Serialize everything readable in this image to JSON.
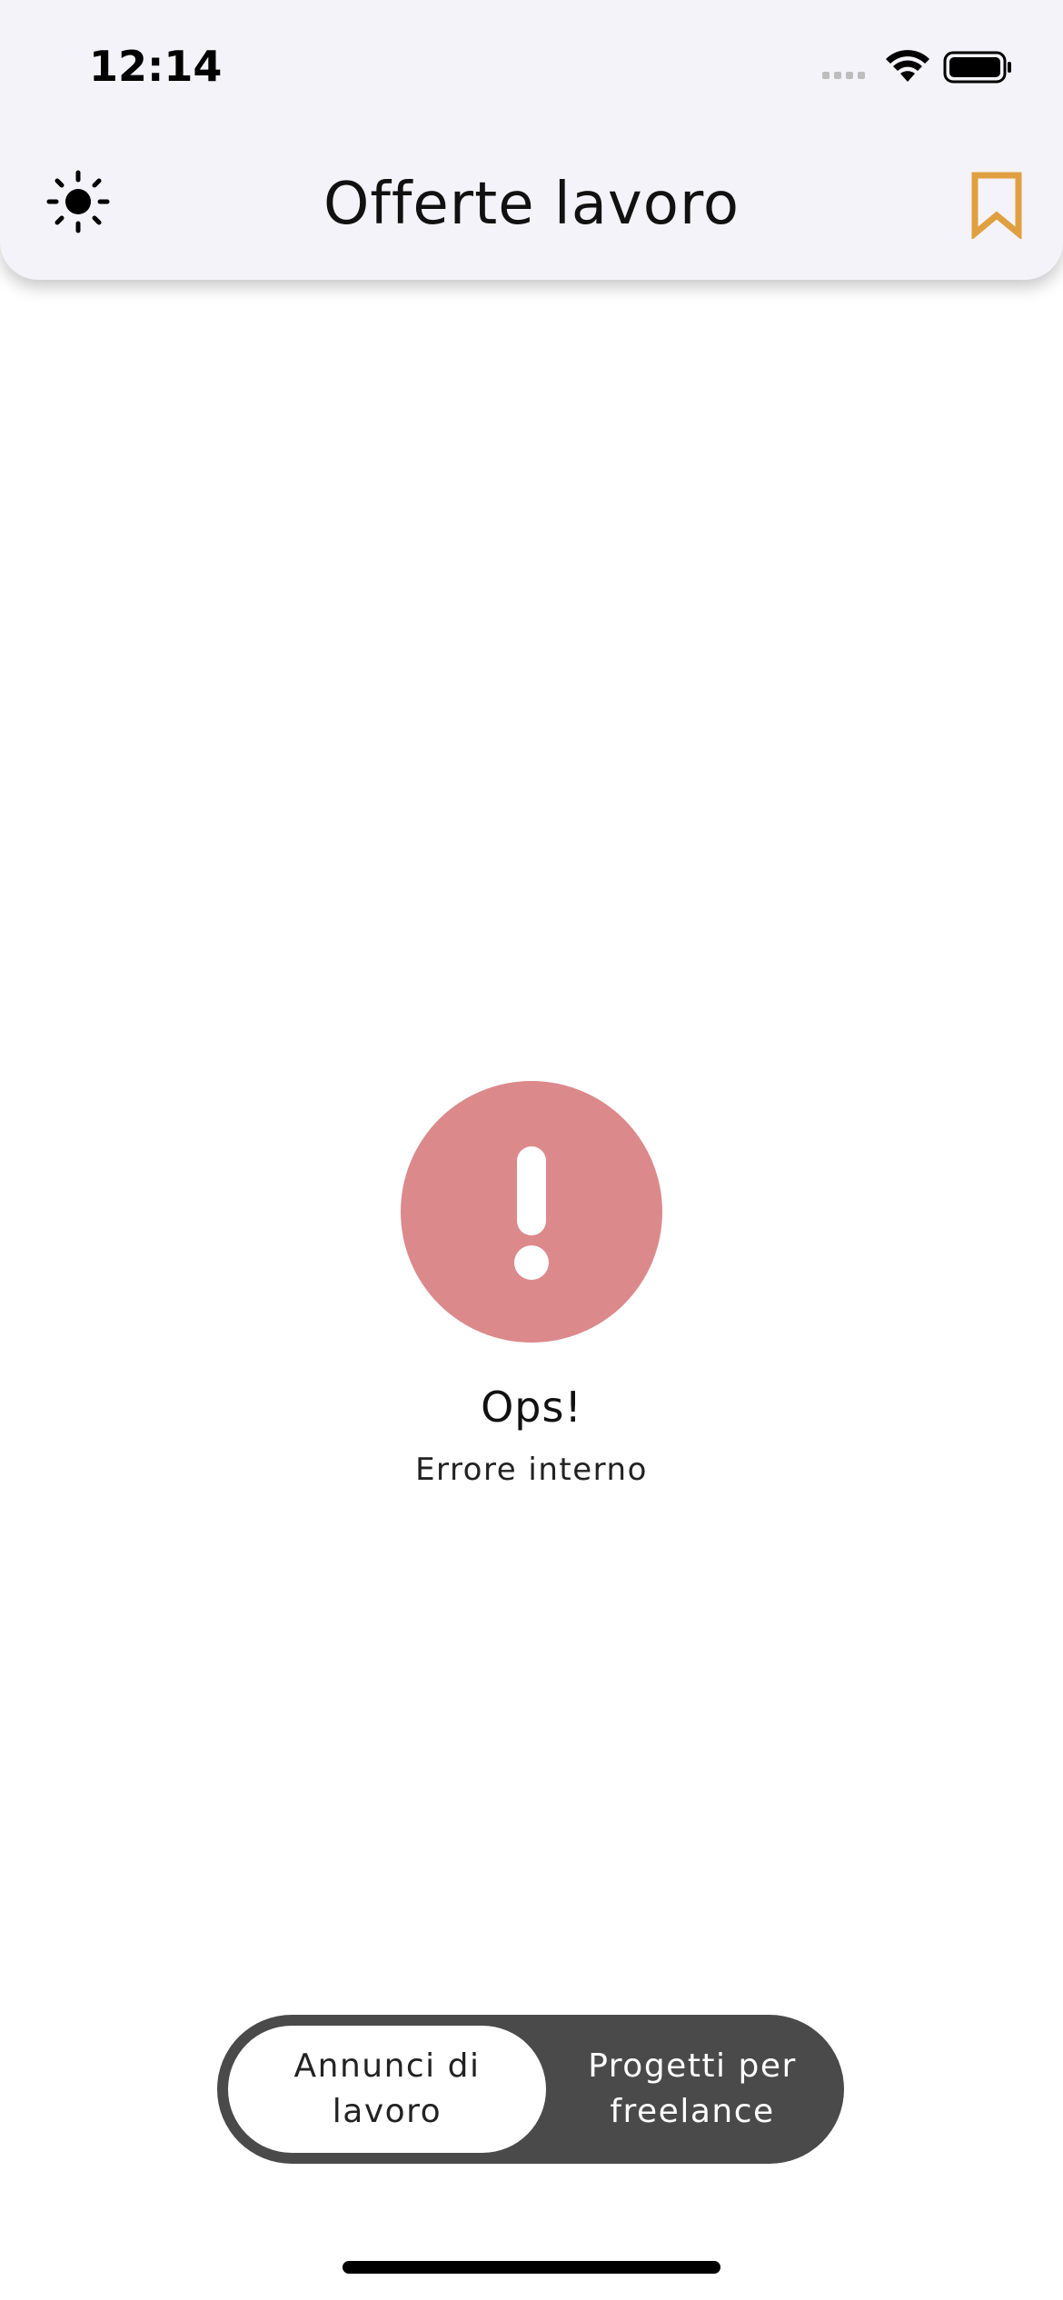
{
  "status_bar": {
    "time": "12:14",
    "icons": [
      "cellular-signal-icon",
      "wifi-icon",
      "battery-icon"
    ]
  },
  "header": {
    "title": "Offerte lavoro",
    "left_icon": "sun-icon",
    "right_icon": "bookmark-icon"
  },
  "error": {
    "icon": "exclamation-icon",
    "title": "Ops!",
    "message": "Errore interno"
  },
  "segmented_control": {
    "options": [
      {
        "label": "Annunci di\nlavoro",
        "selected": true
      },
      {
        "label": "Progetti per\nfreelance",
        "selected": false
      }
    ]
  },
  "colors": {
    "header_bg": "#f4f3f9",
    "bookmark_accent": "#e0a040",
    "error_circle": "#dc898b",
    "segment_bg": "#4a4a4a",
    "segment_active_bg": "#ffffff"
  }
}
